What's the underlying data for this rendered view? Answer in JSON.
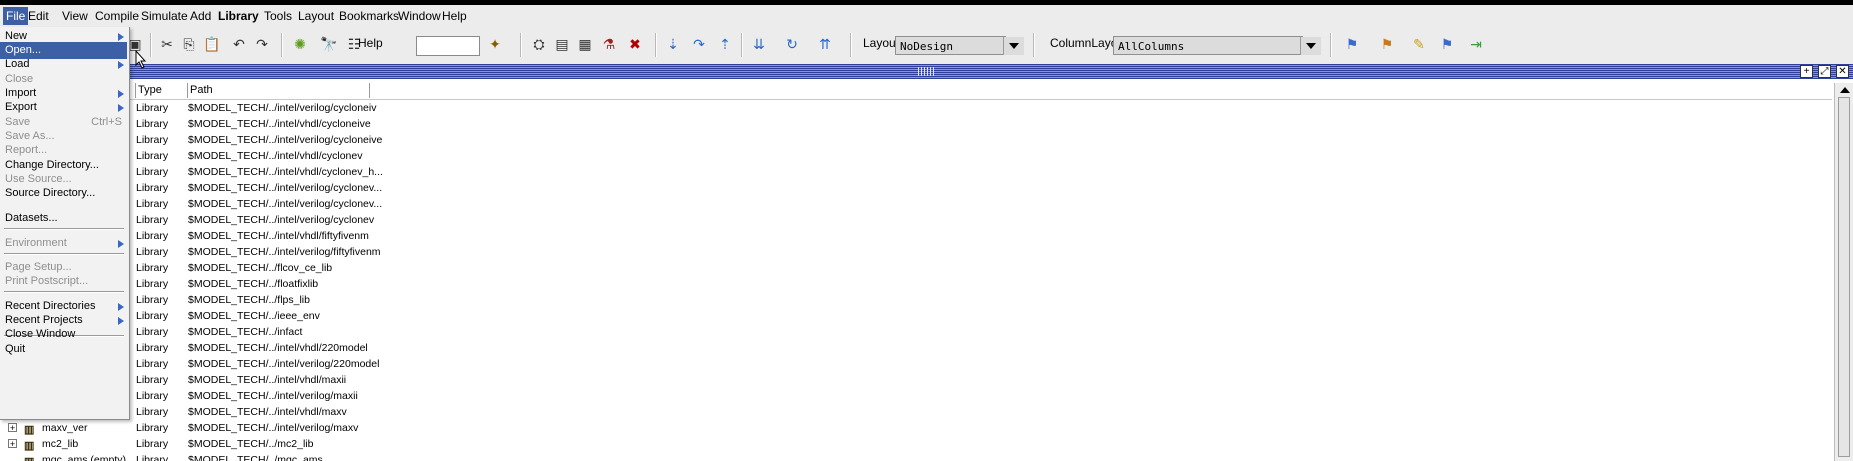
{
  "menubar": {
    "items": [
      "File",
      "Edit",
      "View",
      "Compile",
      "Simulate",
      "Add",
      "Library",
      "Tools",
      "Layout",
      "Bookmarks",
      "Window",
      "Help"
    ]
  },
  "toolbar": {
    "help_label": "Help",
    "layout_label": "Layout",
    "layout_value": "NoDesign",
    "column_layout_label": "ColumnLayout",
    "column_layout_value": "AllColumns"
  },
  "file_menu": {
    "items": [
      {
        "label": "New",
        "enabled": true,
        "submenu": true
      },
      {
        "label": "Open...",
        "enabled": true,
        "highlighted": true
      },
      {
        "label": "Load",
        "enabled": true,
        "submenu": true
      },
      {
        "label": "Close",
        "enabled": false
      },
      {
        "label": "Import",
        "enabled": true,
        "submenu": true
      },
      {
        "label": "Export",
        "enabled": true,
        "submenu": true
      },
      {
        "label": "Save",
        "enabled": false,
        "accel": "Ctrl+S"
      },
      {
        "label": "Save As...",
        "enabled": false
      },
      {
        "label": "Report...",
        "enabled": false
      },
      {
        "label": "Change Directory...",
        "enabled": true
      },
      {
        "label": "Use Source...",
        "enabled": false
      },
      {
        "label": "Source Directory...",
        "enabled": true
      },
      {
        "label": "Datasets...",
        "enabled": true
      },
      {
        "label": "Environment",
        "enabled": false,
        "submenu": true
      },
      {
        "label": "Page Setup...",
        "enabled": false
      },
      {
        "label": "Print Postscript...",
        "enabled": false
      },
      {
        "label": "Recent Directories",
        "enabled": true,
        "submenu": true
      },
      {
        "label": "Recent Projects",
        "enabled": true,
        "submenu": true
      },
      {
        "label": "Close Window",
        "enabled": true
      },
      {
        "label": "Quit",
        "enabled": true
      }
    ]
  },
  "library": {
    "columns": [
      "Type",
      "Path"
    ],
    "rows": [
      {
        "name": "",
        "type": "Library",
        "path": "$MODEL_TECH/../intel/verilog/cycloneiv"
      },
      {
        "name": "",
        "type": "Library",
        "path": "$MODEL_TECH/../intel/vhdl/cycloneive"
      },
      {
        "name": "",
        "type": "Library",
        "path": "$MODEL_TECH/../intel/verilog/cycloneive"
      },
      {
        "name": "",
        "type": "Library",
        "path": "$MODEL_TECH/../intel/vhdl/cyclonev"
      },
      {
        "name": "",
        "type": "Library",
        "path": "$MODEL_TECH/../intel/vhdl/cyclonev_h..."
      },
      {
        "name": "",
        "type": "Library",
        "path": "$MODEL_TECH/../intel/verilog/cyclonev..."
      },
      {
        "name": "",
        "type": "Library",
        "path": "$MODEL_TECH/../intel/verilog/cyclonev..."
      },
      {
        "name": "",
        "type": "Library",
        "path": "$MODEL_TECH/../intel/verilog/cyclonev"
      },
      {
        "name": "",
        "type": "Library",
        "path": "$MODEL_TECH/../intel/vhdl/fiftyfivenm"
      },
      {
        "name": "",
        "type": "Library",
        "path": "$MODEL_TECH/../intel/verilog/fiftyfivenm"
      },
      {
        "name": "",
        "type": "Library",
        "path": "$MODEL_TECH/../flcov_ce_lib"
      },
      {
        "name": "",
        "type": "Library",
        "path": "$MODEL_TECH/../floatfixlib"
      },
      {
        "name": "",
        "type": "Library",
        "path": "$MODEL_TECH/../flps_lib"
      },
      {
        "name": "",
        "type": "Library",
        "path": "$MODEL_TECH/../ieee_env"
      },
      {
        "name": "",
        "type": "Library",
        "path": "$MODEL_TECH/../infact"
      },
      {
        "name": "",
        "type": "Library",
        "path": "$MODEL_TECH/../intel/vhdl/220model"
      },
      {
        "name": "",
        "type": "Library",
        "path": "$MODEL_TECH/../intel/verilog/220model"
      },
      {
        "name": "",
        "type": "Library",
        "path": "$MODEL_TECH/../intel/vhdl/maxii"
      },
      {
        "name": "",
        "type": "Library",
        "path": "$MODEL_TECH/../intel/verilog/maxii"
      },
      {
        "name": "",
        "type": "Library",
        "path": "$MODEL_TECH/../intel/vhdl/maxv"
      },
      {
        "name": "maxv_ver",
        "type": "Library",
        "path": "$MODEL_TECH/../intel/verilog/maxv"
      },
      {
        "name": "mc2_lib",
        "type": "Library",
        "path": "$MODEL_TECH/../mc2_lib"
      },
      {
        "name": "mgc_ams (empty)",
        "type": "Library",
        "path": "$MODEL_TECH/../mgc_ams"
      }
    ]
  }
}
